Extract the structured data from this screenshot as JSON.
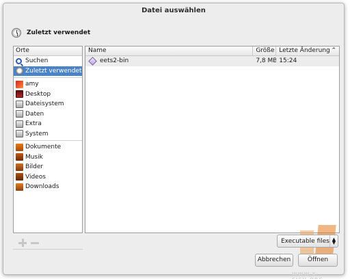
{
  "window": {
    "title": "Datei auswählen"
  },
  "location": {
    "label": "Zuletzt verwendet",
    "icon": "recent-clock-icon"
  },
  "places": {
    "header": "Orte",
    "groups": [
      [
        {
          "label": "Suchen",
          "icon": "search-icon",
          "selected": false
        },
        {
          "label": "Zuletzt verwendet",
          "icon": "recent-icon",
          "selected": true
        }
      ],
      [
        {
          "label": "amy",
          "icon": "home-folder-icon",
          "selected": false
        },
        {
          "label": "Desktop",
          "icon": "desktop-icon",
          "selected": false
        },
        {
          "label": "Dateisystem",
          "icon": "drive-icon",
          "selected": false
        },
        {
          "label": "Daten",
          "icon": "drive-icon",
          "selected": false
        },
        {
          "label": "Extra",
          "icon": "drive-icon",
          "selected": false
        },
        {
          "label": "System",
          "icon": "drive-icon",
          "selected": false
        }
      ],
      [
        {
          "label": "Dokumente",
          "icon": "documents-folder-icon",
          "selected": false
        },
        {
          "label": "Musik",
          "icon": "music-folder-icon",
          "selected": false
        },
        {
          "label": "Bilder",
          "icon": "pictures-folder-icon",
          "selected": false
        },
        {
          "label": "Videos",
          "icon": "videos-folder-icon",
          "selected": false
        },
        {
          "label": "Downloads",
          "icon": "downloads-folder-icon",
          "selected": false
        }
      ]
    ]
  },
  "files": {
    "columns": {
      "name": "Name",
      "size": "Größe",
      "modified": "Letzte Änderung",
      "sort_indicator": "^"
    },
    "rows": [
      {
        "name": "eets2-bin",
        "size": "7,8 MB",
        "modified": "15:24",
        "icon": "executable-icon"
      }
    ]
  },
  "filter": {
    "selected": "Executable files"
  },
  "buttons": {
    "cancel": "Abbrechen",
    "open": "Öffnen"
  },
  "watermark": {
    "text": "WWW.X-FISH.ORG"
  },
  "colors": {
    "selection": "#4b84c6",
    "background": "#ededed"
  }
}
